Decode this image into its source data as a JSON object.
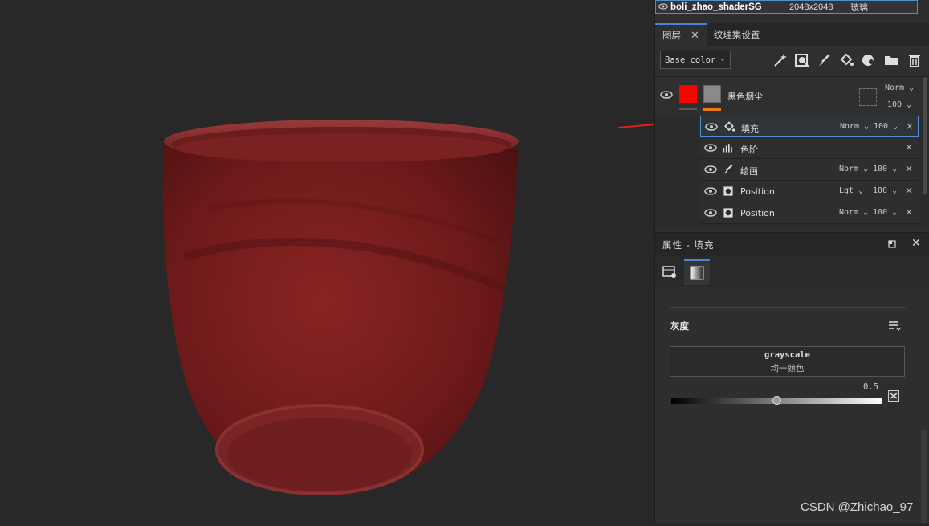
{
  "texture_set": {
    "name": "boli_zhao_shaderSG",
    "resolution": "2048x2048",
    "material": "玻璃"
  },
  "tabs": [
    {
      "label": "图层",
      "active": true
    },
    {
      "label": "纹理集设置",
      "active": false
    }
  ],
  "toolbar": {
    "channel": "Base color",
    "tools": [
      "magic-wand-icon",
      "mask-icon",
      "paint-brush-icon",
      "fill-bucket-icon",
      "color-picker-icon",
      "folder-icon",
      "trash-icon"
    ]
  },
  "layers": {
    "group": {
      "name": "黑色烟尘",
      "blend": "Norm",
      "opacity": "100",
      "swatch_color": "#ff0000",
      "mask_color": "#f07a10"
    },
    "sublayers": [
      {
        "label": "填充",
        "blend": "Norm",
        "opacity": "100",
        "icon": "fill-bucket-icon",
        "selected": true
      },
      {
        "label": "色阶",
        "blend": "",
        "opacity": "",
        "icon": "levels-icon",
        "selected": false
      },
      {
        "label": "绘画",
        "blend": "Norm",
        "opacity": "100",
        "icon": "paint-brush-icon",
        "selected": false
      },
      {
        "label": "Position",
        "blend": "Lgt",
        "opacity": "100",
        "icon": "generator-icon",
        "selected": false
      },
      {
        "label": "Position",
        "blend": "Norm",
        "opacity": "100",
        "icon": "generator-icon",
        "selected": false
      }
    ]
  },
  "properties": {
    "title": "属性 - 填充",
    "section_title": "灰度",
    "input_name": "grayscale",
    "input_type": "均一颜色",
    "value": "0.5",
    "value_fraction": 0.5
  },
  "watermark": "CSDN @Zhichao_97",
  "colors": {
    "accent": "#4a86d1",
    "cup": "#7a1e1e"
  }
}
